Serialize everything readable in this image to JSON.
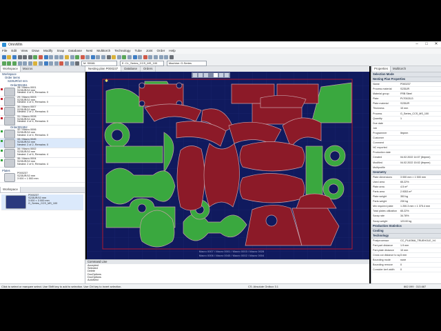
{
  "app": {
    "title": "OmniWin"
  },
  "menu": [
    "File",
    "Edit",
    "View",
    "Draw",
    "Modify",
    "Snap",
    "Database",
    "Nest",
    "Multitorch",
    "Technology",
    "Tube",
    "Joint",
    "Order",
    "Help"
  ],
  "toolbar": {
    "machine_combo": "M: S5581",
    "series_combo": "E: CL_Series_CCS_MS_100",
    "machine_label": "Machine: G-Series"
  },
  "left_panel": {
    "tabs": [
      "Workspace",
      "Macros"
    ],
    "tree": [
      "Workspace",
      "Order items",
      "S235JR/10 mm",
      "Order002451"
    ],
    "parts": [
      {
        "title": "28 / Macro 0001",
        "l1": "S235JR/10 mm",
        "l2": "Nested: 4 of 4, Remains: 0",
        "color": "#c9242f"
      },
      {
        "title": "29 / Macro 0003",
        "l1": "S235JR/10 mm",
        "l2": "Nested: 4 of 4, Remains: 0",
        "color": "#c9242f"
      },
      {
        "title": "30 / Macro 0007",
        "l1": "S235JR/10 mm",
        "l2": "Nested: 2 of 2, Remains: 0",
        "color": "#c9242f"
      },
      {
        "title": "31 / Macro 0028",
        "l1": "S235JR/10 mm",
        "l2": "Nested: 4 of 4, Remains: 0",
        "color": "#c9242f"
      }
    ],
    "order2": "Order002452",
    "parts2": [
      {
        "title": "32 / Macro 0006",
        "l1": "S235JR/10 mm",
        "l2": "Nested: 4 of 4, Remains: 0",
        "color": "#31a339"
      },
      {
        "title": "33 / Macro 0045",
        "l1": "S235JR/10 mm",
        "l2": "Nested: 2 of 2, Remains: 0",
        "color": "#31a339"
      },
      {
        "title": "34 / Macro 0002",
        "l1": "S235JR/10 mm",
        "l2": "Nested: 2 of 6, Remains: 4",
        "color": "#31a339"
      },
      {
        "title": "35 / Macro 0004",
        "l1": "S235JR/10 mm",
        "l2": "Nested: 2 of 6, Remains: 4",
        "color": "#31a339"
      }
    ],
    "plates_label": "Plates",
    "plate_item": {
      "l1": "P000237",
      "l2": "S235JR/10 mm",
      "l3": "3 000 × 1 500 mm"
    },
    "workspace_label": "Workspace",
    "ws_item": {
      "l1": "P000237",
      "l2": "S235JR/10 mm",
      "l3": "3 000 × 3 000 mm",
      "l4": "G_Series_CCS_MS_100"
    }
  },
  "doc_tabs": [
    "Nesting plan P000237",
    "Database",
    "Orders"
  ],
  "command_line": {
    "header": "Command Line",
    "lines": [
      "Accepted",
      "Selected",
      "Delete",
      "DocOptions",
      "DocOptions",
      "AutoNest"
    ]
  },
  "right_panel": {
    "tabs": [
      "Properties",
      "Multitorch"
    ],
    "sections": [
      {
        "title": "Selection Mode",
        "rows": []
      },
      {
        "title": "Nesting Plan Properties",
        "rows": [
          [
            "Name",
            "P000237"
          ],
          [
            "Process material",
            "S235JR"
          ],
          [
            "Material group",
            "FRB Steel"
          ],
          [
            "Plate",
            "PLT002113"
          ],
          [
            "Plate material",
            "S235JR"
          ],
          [
            "Thickness",
            "10 mm"
          ],
          [
            "Process",
            "G_Series_CCS_MS_100"
          ],
          [
            "Quantity",
            "1"
          ],
          [
            "Due date",
            ""
          ],
          [
            "Job",
            ""
          ],
          [
            "Programmer",
            "lbrpnm"
          ],
          [
            "Customer",
            ""
          ],
          [
            "Comment",
            ""
          ],
          [
            "NC exported",
            ""
          ],
          [
            "Production date",
            ""
          ],
          [
            "Created",
            "04.02.2022 14:07 (lbrpnm)"
          ],
          [
            "Modified",
            "04.02.2022 15:02 (lbrpnm)"
          ],
          [
            "Multiprofile",
            ""
          ]
        ]
      },
      {
        "title": "Geometry",
        "rows": [
          [
            "Plate dimensions",
            "3 000 mm  ×  1 500 mm"
          ],
          [
            "Used area",
            "65.22%"
          ],
          [
            "Plate area",
            "4.5 m²"
          ],
          [
            "Parts area",
            "2.9353 m²"
          ],
          [
            "Plate weight",
            "353 kg"
          ],
          [
            "Parts weight",
            "230 kg"
          ],
          [
            "Min required plate",
            "1 200.3 mm × 1 375.4 mm"
          ],
          [
            "Total plates utilization",
            "65.22%"
          ],
          [
            "Scrap rate",
            "34.78%"
          ],
          [
            "Scrap weight",
            "123.00 kg"
          ]
        ]
      },
      {
        "title": "Production Statistics",
        "rows": []
      },
      {
        "title": "Cooling",
        "rows": []
      },
      {
        "title": "Technology",
        "rows": [
          [
            "Postprocessor",
            "CC_PLASMA_TRUEHOLE_V4"
          ],
          [
            "Part-part distance",
            "1.9 mm"
          ],
          [
            "Part-plate distance",
            "10 mm"
          ],
          [
            "Cross cut distance to sq.",
            "5 mm"
          ],
          [
            "Bounding mode",
            "none"
          ],
          [
            "Bounding remove",
            "0"
          ],
          [
            "Consider kerf width",
            "0"
          ]
        ]
      }
    ]
  },
  "status": {
    "left": "Click to select or marquee select. Use Shift key to add to selection. Use Ctrl key to invert selection.",
    "center": "CS: Absolute Ordbox 3.1",
    "right": "862.099 : 313.687"
  },
  "canvas_labels": {
    "red": "Macro 0007 / Macro 0001 / Macro 0003 / Macro 0028",
    "green": "Macro 0006 / Macro 0045 / Macro 0002 / Macro 0004"
  },
  "colors": {
    "part_red": "#8c1a28",
    "part_green": "#3aa83f",
    "canvas_bg": "#101a5e",
    "outline": "#b21b30"
  }
}
